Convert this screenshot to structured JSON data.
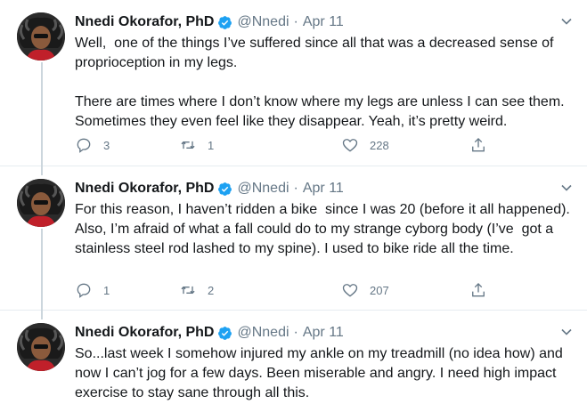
{
  "colors": {
    "verified": "#1da1f2",
    "secondary_text": "#657786",
    "line": "#ccd6dd"
  },
  "tweets": [
    {
      "author_name": "Nnedi Okorafor, PhD",
      "handle": "@Nnedi",
      "separator": "·",
      "date": "Apr 11",
      "text": "Well,  one of the things I’ve suffered since all that was a decreased sense of proprioception in my legs.\n\nThere are times where I don’t know where my legs are unless I can see them. Sometimes they even feel like they disappear. Yeah, it’s pretty weird.",
      "replies": "3",
      "retweets": "1",
      "likes": "228"
    },
    {
      "author_name": "Nnedi Okorafor, PhD",
      "handle": "@Nnedi",
      "separator": "·",
      "date": "Apr 11",
      "text": "For this reason, I haven’t ridden a bike  since I was 20 (before it all happened). Also, I’m afraid of what a fall could do to my strange cyborg body (I’ve  got a stainless steel rod lashed to my spine). I used to bike ride all the time.",
      "replies": "1",
      "retweets": "2",
      "likes": "207"
    },
    {
      "author_name": "Nnedi Okorafor, PhD",
      "handle": "@Nnedi",
      "separator": "·",
      "date": "Apr 11",
      "text": "So...last week I somehow injured my ankle on my treadmill (no idea how) and now I can’t jog for a few days. Been miserable and angry. I need high impact exercise to stay sane through all this."
    }
  ]
}
